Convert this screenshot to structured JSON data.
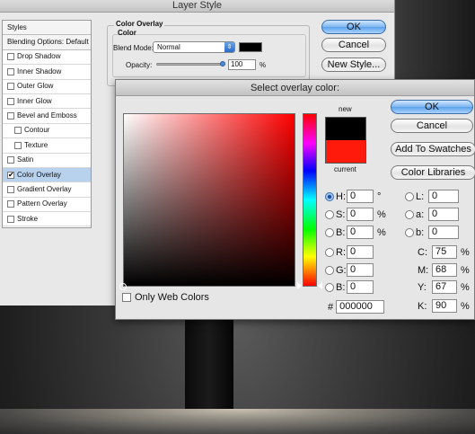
{
  "layer_style": {
    "title": "Layer Style",
    "styles_header": "Styles",
    "blending_options": "Blending Options: Default",
    "items": [
      {
        "label": "Drop Shadow",
        "checked": false
      },
      {
        "label": "Inner Shadow",
        "checked": false
      },
      {
        "label": "Outer Glow",
        "checked": false
      },
      {
        "label": "Inner Glow",
        "checked": false
      },
      {
        "label": "Bevel and Emboss",
        "checked": false
      },
      {
        "label": "Contour",
        "checked": false
      },
      {
        "label": "Texture",
        "checked": false
      },
      {
        "label": "Satin",
        "checked": false
      },
      {
        "label": "Color Overlay",
        "checked": true
      },
      {
        "label": "Gradient Overlay",
        "checked": false
      },
      {
        "label": "Pattern Overlay",
        "checked": false
      },
      {
        "label": "Stroke",
        "checked": false
      }
    ],
    "overlay_title": "Color Overlay",
    "color_group": "Color",
    "blend_mode_label": "Blend Mode:",
    "blend_mode_value": "Normal",
    "opacity_label": "Opacity:",
    "opacity_value": "100",
    "opacity_unit": "%",
    "ok": "OK",
    "cancel": "Cancel",
    "new_style": "New Style..."
  },
  "picker": {
    "title": "Select overlay color:",
    "new_label": "new",
    "current_label": "current",
    "ok": "OK",
    "cancel": "Cancel",
    "add_to_swatches": "Add To Swatches",
    "color_libraries": "Color Libraries",
    "only_web_colors": "Only Web Colors",
    "new_color": "#000000",
    "current_color": "#ff1a0c",
    "hsb": {
      "h_label": "H:",
      "h": "0",
      "h_unit": "°",
      "s_label": "S:",
      "s": "0",
      "s_unit": "%",
      "b_label": "B:",
      "b": "0",
      "b_unit": "%"
    },
    "rgb": {
      "r_label": "R:",
      "r": "0",
      "g_label": "G:",
      "g": "0",
      "b_label": "B:",
      "b": "0"
    },
    "lab": {
      "l_label": "L:",
      "l": "0",
      "a_label": "a:",
      "a": "0",
      "b_label": "b:",
      "b": "0"
    },
    "cmyk": {
      "c_label": "C:",
      "c": "75",
      "m_label": "M:",
      "m": "68",
      "y_label": "Y:",
      "y": "67",
      "k_label": "K:",
      "k": "90",
      "unit": "%"
    },
    "hex_label": "#",
    "hex": "000000"
  }
}
